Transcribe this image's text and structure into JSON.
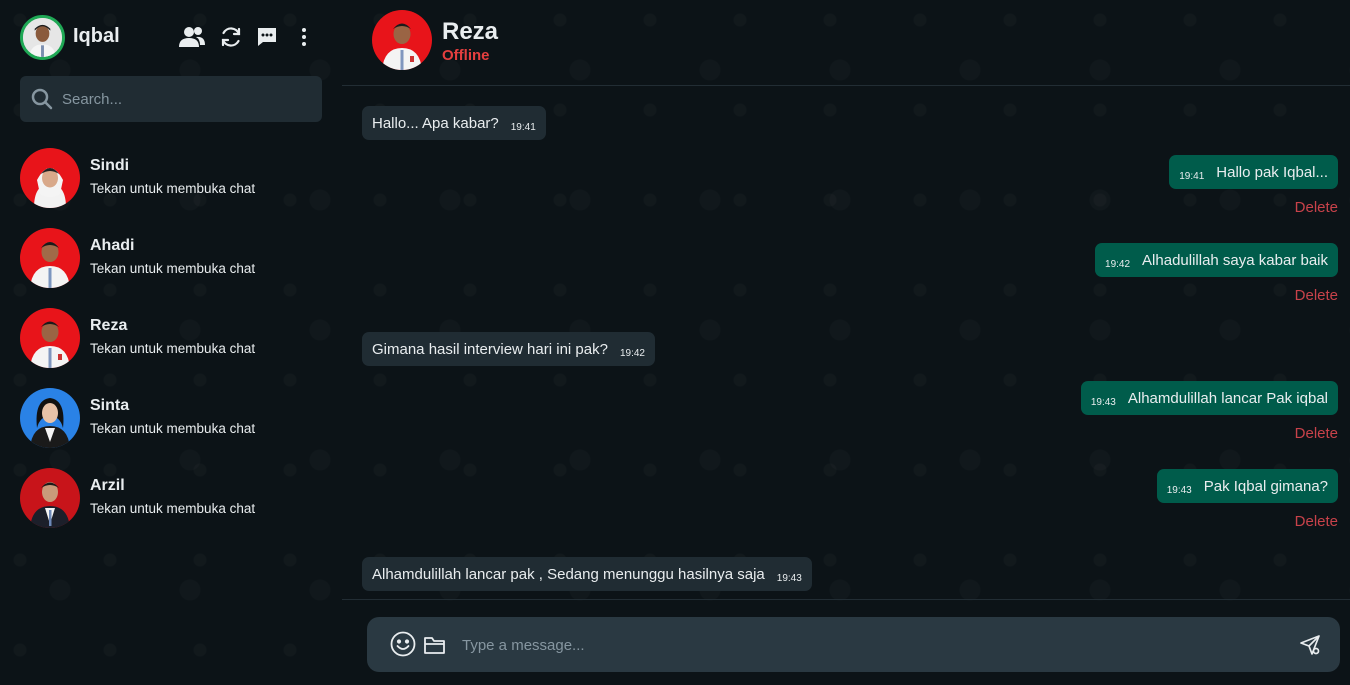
{
  "sidebar": {
    "user_name": "Iqbal",
    "search_placeholder": "Search...",
    "contacts": [
      {
        "name": "Sindi",
        "subtitle": "Tekan untuk membuka chat"
      },
      {
        "name": "Ahadi",
        "subtitle": "Tekan untuk membuka chat"
      },
      {
        "name": "Reza",
        "subtitle": "Tekan untuk membuka chat"
      },
      {
        "name": "Sinta",
        "subtitle": "Tekan untuk membuka chat"
      },
      {
        "name": "Arzil",
        "subtitle": "Tekan untuk membuka chat"
      }
    ],
    "icons": [
      "contacts-icon",
      "refresh-icon",
      "new-chat-icon",
      "more-options-icon"
    ]
  },
  "chat": {
    "peer_name": "Reza",
    "peer_status": "Offline",
    "delete_label": "Delete",
    "messages": [
      {
        "direction": "in",
        "text": "Hallo... Apa kabar?",
        "time": "19:41"
      },
      {
        "direction": "out",
        "text": "Hallo pak Iqbal...",
        "time": "19:41"
      },
      {
        "direction": "out",
        "text": "Alhadulillah saya kabar baik",
        "time": "19:42"
      },
      {
        "direction": "in",
        "text": "Gimana hasil interview hari ini pak?",
        "time": "19:42"
      },
      {
        "direction": "out",
        "text": "Alhamdulillah lancar Pak iqbal",
        "time": "19:43"
      },
      {
        "direction": "out",
        "text": "Pak Iqbal gimana?",
        "time": "19:43"
      },
      {
        "direction": "in",
        "text": "Alhamdulillah lancar pak , Sedang menunggu hasilnya saja",
        "time": "19:43"
      }
    ]
  },
  "composer": {
    "placeholder": "Type a message..."
  },
  "colors": {
    "background": "#0c1317",
    "incoming_bubble": "#202c33",
    "outgoing_bubble": "#005c4b",
    "offline_status": "#e53f3f",
    "delete_text": "#c8424a",
    "online_ring": "#1fa855"
  }
}
